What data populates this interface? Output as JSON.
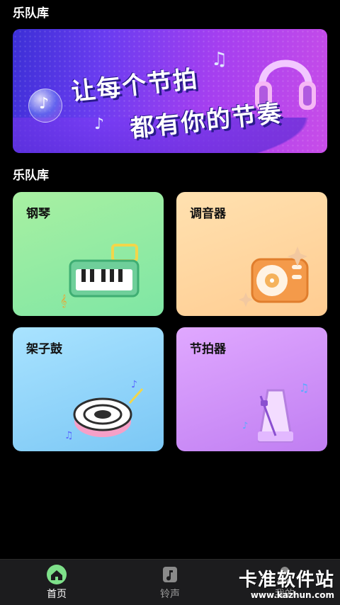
{
  "header": {
    "title": "乐队库"
  },
  "banner": {
    "line1": "让每个节拍",
    "line2": "都有你的节奏"
  },
  "section": {
    "title": "乐队库"
  },
  "cards": [
    {
      "label": "钢琴",
      "icon": "piano-icon"
    },
    {
      "label": "调音器",
      "icon": "turntable-icon"
    },
    {
      "label": "架子鼓",
      "icon": "drum-icon"
    },
    {
      "label": "节拍器",
      "icon": "metronome-icon"
    }
  ],
  "tabbar": {
    "items": [
      {
        "label": "首页",
        "icon": "home-icon",
        "active": true
      },
      {
        "label": "铃声",
        "icon": "music-note-icon",
        "active": false
      },
      {
        "label": "我的",
        "icon": "user-icon",
        "active": false
      }
    ]
  },
  "watermark": {
    "text": "卡准软件站",
    "url": "www.kazhun.com"
  },
  "colors": {
    "background": "#000000",
    "tabbar": "#1c1c1e",
    "active_tab_icon_bg": "#7ee08a",
    "inactive_tab_text": "#9a9a9a"
  }
}
